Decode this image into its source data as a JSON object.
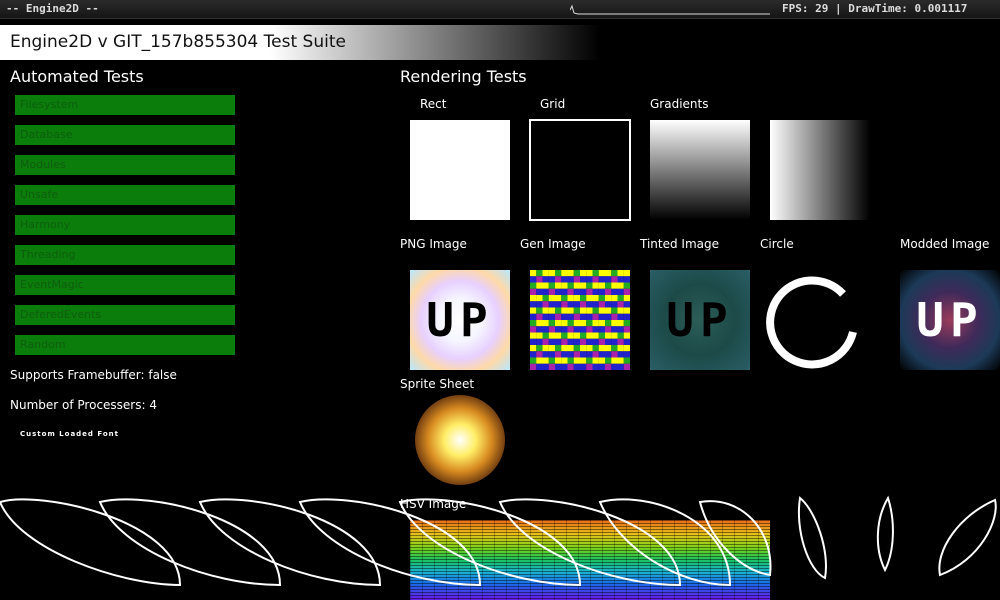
{
  "topbar": {
    "title": "-- Engine2D --",
    "stats": "FPS: 29 | DrawTime: 0.001117"
  },
  "banner": {
    "title": "Engine2D v GIT_157b855304 Test Suite"
  },
  "automated": {
    "title": "Automated Tests",
    "tests": [
      "Filesystem",
      "Database",
      "Modules",
      "Unsafe",
      "Harmony",
      "Threading",
      "EventMagic",
      "DeferedEvents",
      "Random"
    ]
  },
  "info": {
    "framebuffer": "Supports Framebuffer: false",
    "processors": "Number of Processers: 4",
    "custom_font": "Custom Loaded Font"
  },
  "rendering": {
    "title": "Rendering Tests",
    "labels": {
      "rect": "Rect",
      "grid": "Grid",
      "gradients": "Gradients",
      "png": "PNG Image",
      "gen": "Gen Image",
      "tinted": "Tinted Image",
      "circle": "Circle",
      "modded": "Modded Image",
      "sprite": "Sprite Sheet",
      "hsv": "HSV Image"
    },
    "image_text": "UP"
  },
  "colors": {
    "test_button": "#0a7d0a",
    "test_button_text": "#0f5d0f"
  }
}
